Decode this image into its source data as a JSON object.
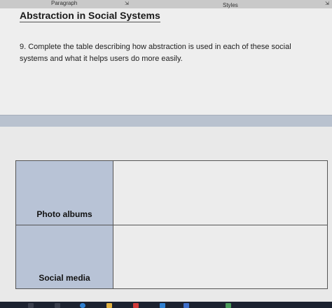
{
  "ribbon": {
    "paragraph_label": "Paragraph",
    "styles_label": "Styles"
  },
  "document": {
    "title": "Abstraction in Social Systems",
    "question": "9. Complete the table describing how abstraction is used in each of these social systems and what it helps users do more easily."
  },
  "table": {
    "rows": [
      {
        "label": "Photo albums",
        "answer": ""
      },
      {
        "label": "Social media",
        "answer": ""
      }
    ]
  },
  "colors": {
    "label_cell": "#b8c3d6",
    "taskbar": "#1c2230",
    "accent_icon": "#2f80d1"
  },
  "taskbar": {
    "icons": [
      "edge-icon",
      "folder-icon",
      "store-icon",
      "mail-icon",
      "app-icon",
      "app-icon-2"
    ]
  }
}
